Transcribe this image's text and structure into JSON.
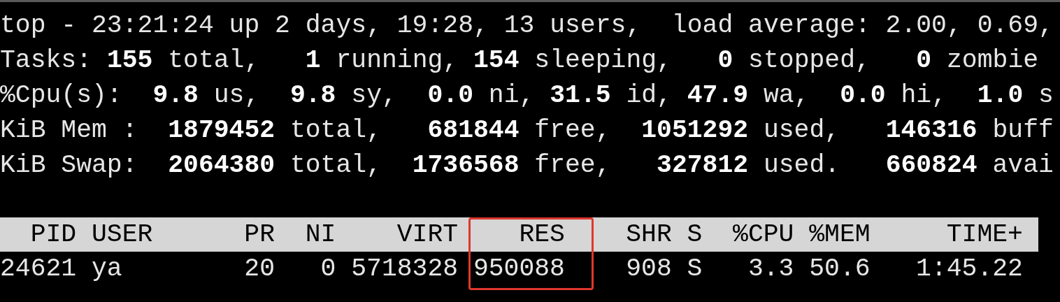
{
  "summary_lines": [
    "top - 23:21:24 up 2 days, 19:28, 13 users,  load average: 2.00, 0.69,",
    "Tasks: **155** total,   **1** running, **154** sleeping,   **0** stopped,   **0** zombie",
    "%Cpu(s):  **9.8** us,  **9.8** sy,  **0.0** ni, **31.5** id, **47.9** wa,  **0.0** hi,  **1.0** s",
    "KiB Mem :  **1879452** total,   **681844** free,  **1051292** used,   **146316** buff",
    "KiB Swap:  **2064380** total,  **1736568** free,   **327812** used.   **660824** avai"
  ],
  "table": {
    "columns": [
      {
        "label": "PID",
        "boxed": false
      },
      {
        "label": "USER",
        "boxed": false
      },
      {
        "label": "PR",
        "boxed": false
      },
      {
        "label": "NI",
        "boxed": false
      },
      {
        "label": "VIRT",
        "boxed": false
      },
      {
        "label": "RES",
        "boxed": true
      },
      {
        "label": "SHR",
        "boxed": false
      },
      {
        "label": "S",
        "boxed": false
      },
      {
        "label": "%CPU",
        "boxed": false
      },
      {
        "label": "%MEM",
        "boxed": false
      },
      {
        "label": "TIME+",
        "boxed": false
      }
    ],
    "rows": [
      [
        "24621",
        "ya",
        "20",
        "0",
        "5718328",
        "950088",
        "908",
        "S",
        "3.3",
        "50.6",
        "1:45.22"
      ]
    ]
  }
}
